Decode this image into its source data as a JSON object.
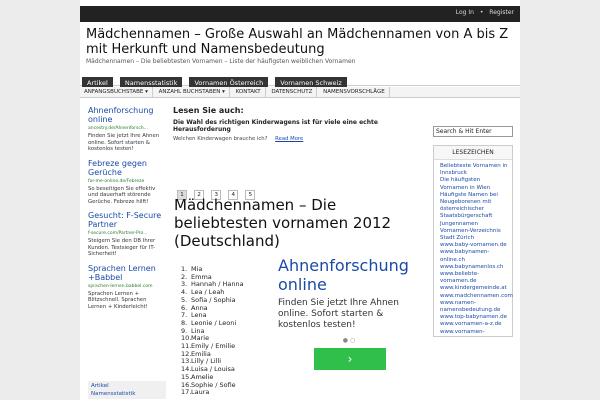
{
  "top_links": [
    "Log In",
    "Register"
  ],
  "site": {
    "title": "Mädchennamen – Große Auswahl an Mädchennamen von A bis Z mit Herkunft und Namensbedeutung",
    "description": "Mädchennamen – Die beliebtesten Vornamen – Liste der häufigsten weiblichen Vornamen"
  },
  "nav_primary": [
    "Artikel",
    "Namensstatistik",
    "Vornamen Österreich",
    "Vornamen Schweiz"
  ],
  "nav_secondary": [
    "ANFANGSBUCHSTABE ▾",
    "ANZAHL BUCHSTABEN ▾",
    "KONTAKT",
    "DATENSCHUTZ",
    "NAMENSVORSCHLÄGE"
  ],
  "left_ads": [
    {
      "title": "Ahnenforschung online",
      "url": "ancestry.de/Ahnenforsch...",
      "text": "Finden Sie jetzt Ihre Ahnen online. Sofort starten & kostenlos testen!"
    },
    {
      "title": "Febreze gegen Gerüche",
      "url": "for-me-online.de/Febreze",
      "text": "So beseitigen Sie effektiv und dauerhaft störende Gerüche. Febreze hilft!"
    },
    {
      "title": "Gesucht: F-Secure Partner",
      "url": "f-secure.com/Partner-Pro...",
      "text": "Steigern Sie den DB Ihrer Kunden. Testsieger für IT-Sicherheit!"
    },
    {
      "title": "Sprachen Lernen +Babbel",
      "url": "sprachen-lernen.babbel.com",
      "text": "Sprachen Lernen + Blitzschnell. Sprachen Lernen + Kinderleicht!"
    }
  ],
  "left_menu": [
    "Artikel",
    "Namensstatistik"
  ],
  "main": {
    "section_heading": "Lesen Sie auch:",
    "article_title": "Die Wahl des richtigen Kinderwagens ist für viele eine echte Herausforderung",
    "article_excerpt": "Welchen Kinderwagen brauche ich?",
    "read_more": "Read More",
    "pages": [
      "1",
      "2",
      "3",
      "4",
      "5"
    ],
    "page_title": "Mädchennamen – Die beliebtesten vornamen 2012 (Deutschland)",
    "names": [
      "Mia",
      "Emma",
      "Hannah / Hanna",
      "Lea / Leah",
      "Sofia / Sophia",
      "Anna",
      "Lena",
      "Leonie / Leoni",
      "Lina",
      "Marie",
      "Emily / Emilie",
      "Emilia",
      "Lilly / Lilli",
      "Luisa / Louisa",
      "Amelie",
      "Sophie / Sofie",
      "Laura"
    ]
  },
  "big_ad": {
    "title": "Ahnenforschung online",
    "text": "Finden Sie jetzt Ihre Ahnen online. Sofort starten & kostenlos testen!",
    "dots": "● ○",
    "button": "›"
  },
  "right": {
    "search_value": "Search & Hit Enter",
    "lesezeichen_header": "LESEZEICHEN",
    "links": [
      "Beliebteste Vornamen in Innsbruck",
      "Die häufigsten Vornamen in Wien",
      "Häufigste Namen bei Neugeborenen mit österreichischer Staatsbürgerschaft",
      "Jungennamen",
      "Vornamen-Verzeichnis Stadt Zürich",
      "www.baby-vornamen.de",
      "www.babynamen-online.ch",
      "www.babynamenlos.ch",
      "www.beliebte-vornamen.de",
      "www.kindergemeinde.at",
      "www.madchennamen.com",
      "www.namen-namensbedeutung.de",
      "www.top-babynamen.de",
      "www.vornamen-a-z.de",
      "www.vornamen-"
    ]
  },
  "colors": {
    "link": "#1a4aa8",
    "topbar": "#222222",
    "ad_button": "#2fbf4a"
  }
}
